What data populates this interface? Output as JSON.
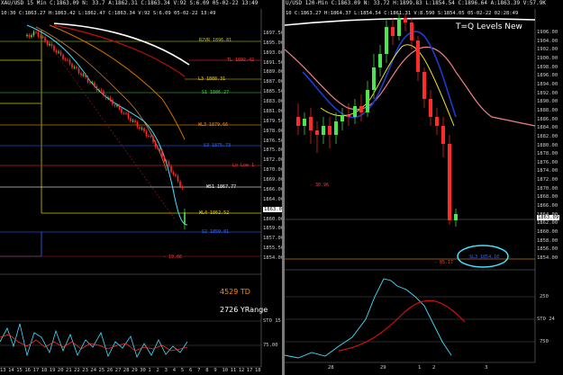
{
  "left_chart": {
    "header": "XAU/USD 15 Min  C:1863.09  N:  33.7  A:1862.31  C:1863.34  V:92  S:6.09  05-02-22  13:49",
    "header2": "10:30  C:1863.27  H:1863.42  L:1862.47  C:1863.34  V:92  S:6.09  05-02-22  13:49",
    "price_ticks": [
      "1897.50",
      "1895.00",
      "1893.00",
      "1891.50",
      "1889.00",
      "1887.00",
      "1885.50",
      "1883.00",
      "1881.00",
      "1879.50",
      "1878.00",
      "1876.50",
      "1875.00",
      "1872.00",
      "1870.00",
      "1869.00",
      "1866.00",
      "1864.00",
      "1861.50",
      "1860.00",
      "1859.00",
      "1857.00",
      "1855.50",
      "1854.00"
    ],
    "price_box": "1863.09",
    "levels": [
      {
        "label": "R2VR 1896.81",
        "color": "#d4c400"
      },
      {
        "label": "TL 1892.42",
        "color": "#ff3a3a"
      },
      {
        "label": "L3 1888.31",
        "color": "#f2d200"
      },
      {
        "label": "S1 1886.27",
        "color": "#4fd64f"
      },
      {
        "label": "WL3 1879.66",
        "color": "#ff8c00"
      },
      {
        "label": "S3 1875.73",
        "color": "#2d6bff"
      },
      {
        "label": "Lo Low 1",
        "color": "#ff3a3a"
      },
      {
        "label": "W51 1867.77",
        "color": "#ffffff"
      },
      {
        "label": "WL4 1862.52",
        "color": "#f2d200"
      },
      {
        "label": "S2 1859.81",
        "color": "#2d6bff"
      },
      {
        "label": "- 19.66",
        "color": "#ff3a3a"
      }
    ],
    "indicator": {
      "td_label": "4529 TD",
      "yrange_label": "2726 YRange",
      "rsi_ticks": [
        "STO 15",
        "75.00"
      ]
    },
    "time_ticks": [
      "13",
      "14",
      "15",
      "16",
      "17",
      "18",
      "19",
      "20",
      "21",
      "22",
      "23",
      "24",
      "25",
      "26",
      "27",
      "28",
      "29",
      "30",
      "1",
      "2",
      "3",
      "4",
      "5",
      "6",
      "7",
      "8",
      "9",
      "10",
      "11",
      "12",
      "17",
      "18"
    ]
  },
  "right_chart": {
    "header": "U/USD 120-Min  C:1863.09  N:  33.72  H:1899.83  L:1854.54  C:1896.64  A:1863.39  V:57.9K",
    "header2": "10  C:1863.27  H:1864.37  L:1854.54  C:1861.31  V:8.590  S:1854.05  05-02-22  02:28:49",
    "title": "T=Q Levels New",
    "price_ticks": [
      "1906.00",
      "1904.00",
      "1902.00",
      "1900.00",
      "1898.00",
      "1896.00",
      "1894.00",
      "1892.00",
      "1890.00",
      "1888.00",
      "1886.00",
      "1884.00",
      "1882.00",
      "1880.00",
      "1878.00",
      "1876.00",
      "1874.00",
      "1872.00",
      "1870.00",
      "1868.00",
      "1866.00",
      "1864.00",
      "1862.00",
      "1860.00",
      "1858.00",
      "1856.00",
      "1854.00"
    ],
    "price_box": "1863.09",
    "levels": [
      {
        "label": "- 30.96",
        "color": "#ff3a3a"
      },
      {
        "label": "- 85.17",
        "color": "#ff3a3a"
      },
      {
        "label": "SL3 1854.10",
        "color": "#2d6bff"
      }
    ],
    "indicator_ticks": [
      "250",
      "STO 24",
      "750"
    ],
    "time_ticks": [
      "28",
      "29",
      "1",
      "2",
      "3"
    ]
  },
  "colors": {
    "bull": "#4fe34f",
    "bear": "#ff2a2a",
    "cyan": "#40e0ff"
  }
}
